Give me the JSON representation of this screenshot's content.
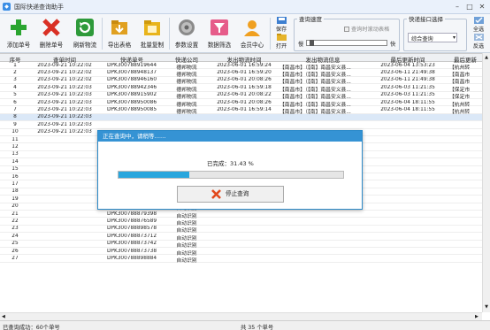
{
  "window": {
    "title": "国际快递查询助手",
    "controls": [
      "–",
      "□",
      "✕"
    ]
  },
  "toolbar": {
    "buttons": [
      {
        "label": "添加单号",
        "icon": "add-icon",
        "color": "#2aa530"
      },
      {
        "label": "删除单号",
        "icon": "delete-icon",
        "color": "#d93025"
      },
      {
        "label": "刷新物流",
        "icon": "refresh-icon",
        "color": "#2e9a3a"
      },
      {
        "label": "导出表格",
        "icon": "export-icon",
        "color": "#e0a020"
      },
      {
        "label": "批量复制",
        "icon": "copy-icon",
        "color": "#e8b41c"
      },
      {
        "label": "参数设置",
        "icon": "gear-icon",
        "color": "#777777"
      },
      {
        "label": "数据筛选",
        "icon": "filter-icon",
        "color": "#e65c8a"
      },
      {
        "label": "会员中心",
        "icon": "member-icon",
        "color": "#f0a020"
      }
    ],
    "save_label": "保存",
    "open_label": "打开",
    "speed_group": {
      "legend": "查询速度",
      "auto_scroll": "查询时滚动表格",
      "slow": "慢",
      "fast": "快",
      "level": 0.03
    },
    "api_group": {
      "legend": "快递接口选择",
      "selected": "综合查询",
      "all_select": "全选",
      "invert_select": "反选"
    }
  },
  "table": {
    "columns": [
      "序号",
      "查单时间",
      "快递单号",
      "快递公司",
      "发出物流时间",
      "发出物流信息",
      "最后更新时间",
      "最后更新"
    ],
    "rows": [
      [
        "1",
        "2023-09-21 10:22:02",
        "DPK300788919644",
        "德邦物流",
        "2023-06-01 16:59:24",
        "【南昌市】（【南】南昌安义县...",
        "2023-06-04 13:53:23",
        "【杭州转"
      ],
      [
        "2",
        "2023-09-21 10:22:02",
        "DPK300788948137",
        "德邦物流",
        "2023-06-01 16:59:20",
        "【南昌市】（【南】南昌安义县...",
        "2023-06-11 21:49:38",
        "【南昌市"
      ],
      [
        "3",
        "2023-09-21 10:22:02",
        "DPK300788946160",
        "德邦物流",
        "2023-06-01 20:08:26",
        "【南昌市】（【南】南昌安义县...",
        "2023-06-11 21:49:38",
        "【南昌市"
      ],
      [
        "4",
        "2023-09-21 10:22:03",
        "DPK300788942346",
        "德邦物流",
        "2023-06-01 16:59:18",
        "【南昌市】（【南】南昌安义县...",
        "2023-06-03 11:21:35",
        "【保定市"
      ],
      [
        "5",
        "2023-09-21 10:22:03",
        "DPK300788915902",
        "德邦物流",
        "2023-06-01 20:08:22",
        "【南昌市】（【南】南昌安义县...",
        "2023-06-03 11:21:35",
        "【保定市"
      ],
      [
        "6",
        "2023-09-21 10:22:03",
        "DPK300788950086",
        "德邦物流",
        "2023-06-01 20:08:26",
        "【南昌市】（【南】南昌安义县...",
        "2023-06-04 18:11:55",
        "【杭州转"
      ],
      [
        "7",
        "2023-09-21 10:22:03",
        "DPK300788950085",
        "德邦物流",
        "2023-06-01 16:59:14",
        "【南昌市】（【南】南昌安义县...",
        "2023-06-04 18:11:55",
        "【杭州转"
      ],
      [
        "8",
        "2023-09-21 10:22:03",
        "",
        "",
        "",
        "",
        "",
        ""
      ],
      [
        "9",
        "2023-09-21 10:22:03",
        "",
        "",
        "",
        "",
        "",
        ""
      ],
      [
        "10",
        "2023-09-21 10:22:03",
        "",
        "",
        "",
        "",
        "",
        ""
      ],
      [
        "11",
        "",
        "",
        "",
        "",
        "",
        "",
        ""
      ],
      [
        "12",
        "",
        "",
        "",
        "",
        "",
        "",
        ""
      ],
      [
        "13",
        "",
        "",
        "",
        "",
        "",
        "",
        ""
      ],
      [
        "14",
        "",
        "",
        "",
        "",
        "",
        "",
        ""
      ],
      [
        "15",
        "",
        "",
        "",
        "",
        "",
        "",
        ""
      ],
      [
        "16",
        "",
        "",
        "",
        "",
        "",
        "",
        ""
      ],
      [
        "17",
        "",
        "DPK264159352845",
        "自动识别",
        "",
        "",
        "",
        ""
      ],
      [
        "18",
        "",
        "DPK202177838038",
        "自动识别",
        "",
        "",
        "",
        ""
      ],
      [
        "19",
        "",
        "DPK300788896103",
        "自动识别",
        "",
        "",
        "",
        ""
      ],
      [
        "20",
        "",
        "DPK300788873718",
        "自动识别",
        "",
        "",
        "",
        ""
      ],
      [
        "21",
        "",
        "DPK300788879398",
        "自动识别",
        "",
        "",
        "",
        ""
      ],
      [
        "22",
        "",
        "DPK300788876589",
        "自动识别",
        "",
        "",
        "",
        ""
      ],
      [
        "23",
        "",
        "DPK300788898578",
        "自动识别",
        "",
        "",
        "",
        ""
      ],
      [
        "24",
        "",
        "DPK300788873712",
        "自动识别",
        "",
        "",
        "",
        ""
      ],
      [
        "25",
        "",
        "DPK300788873742",
        "自动识别",
        "",
        "",
        "",
        ""
      ],
      [
        "26",
        "",
        "DPK300788873738",
        "自动识别",
        "",
        "",
        "",
        ""
      ],
      [
        "27",
        "",
        "DPK300788898884",
        "自动识别",
        "",
        "",
        "",
        ""
      ]
    ],
    "selected_row": 7
  },
  "dialog": {
    "title": "正在查询中，请稍等……",
    "progress_text": "已完成：31.43 %",
    "progress": 0.3143,
    "stop_label": "停止查询"
  },
  "status": {
    "left": "已查询成功：60个单号",
    "right": "共 35 个单号"
  }
}
